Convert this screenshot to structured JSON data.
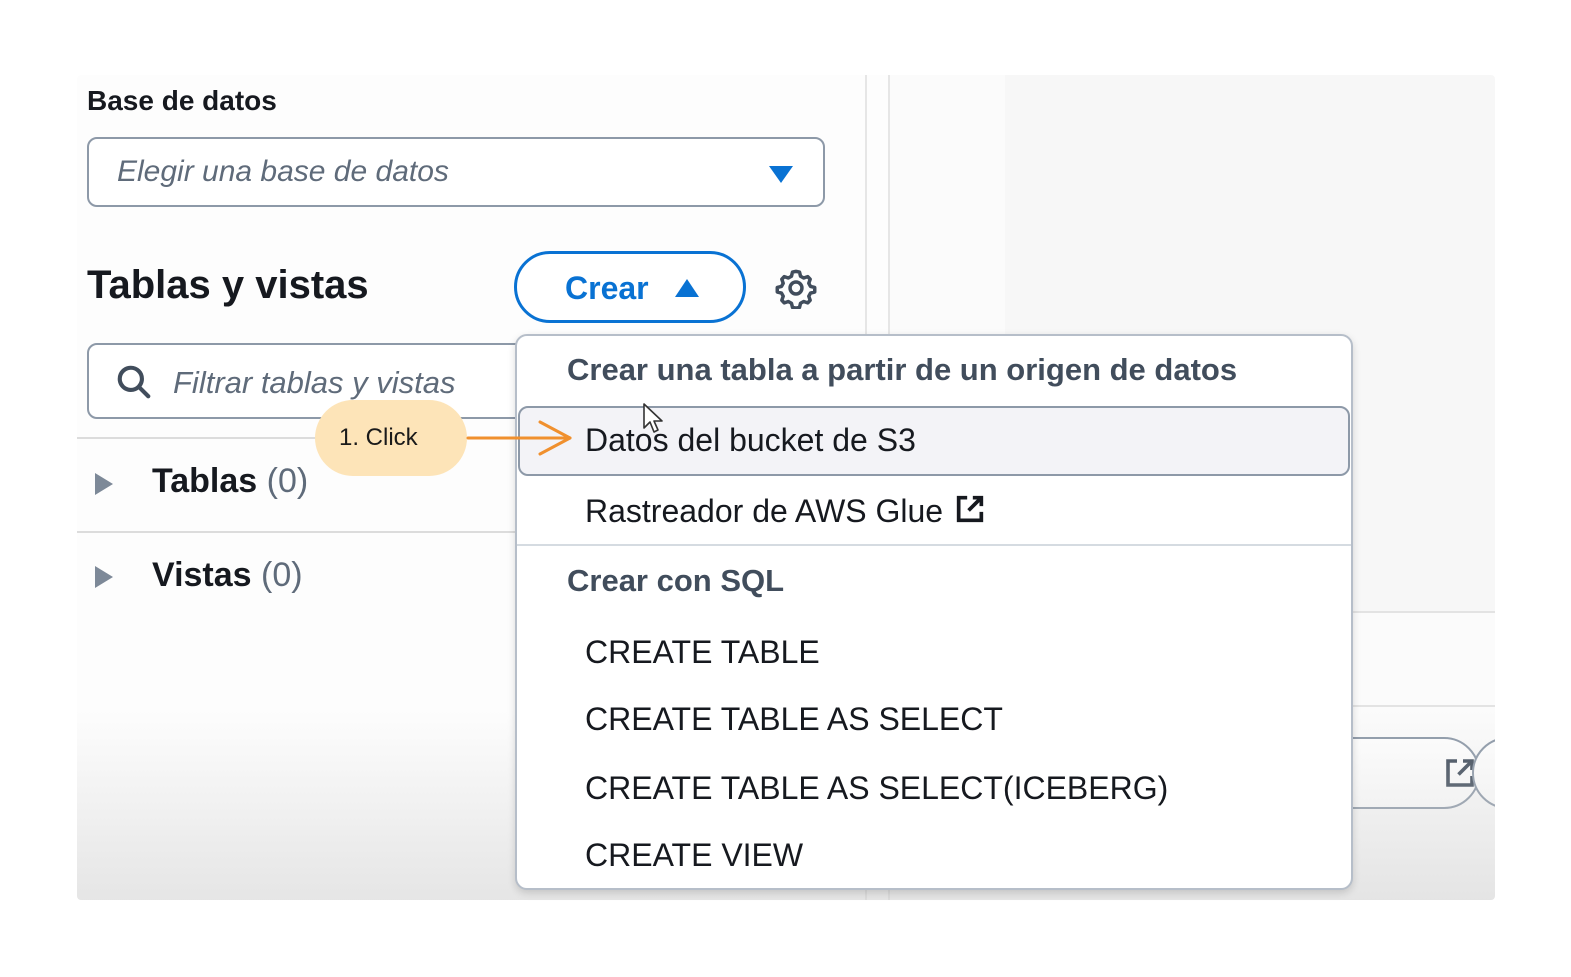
{
  "database": {
    "label": "Base de datos",
    "placeholder": "Elegir una base de datos"
  },
  "tables_views": {
    "title": "Tablas y vistas",
    "create_button": "Crear",
    "filter_placeholder": "Filtrar tablas y vistas",
    "tree": [
      {
        "label": "Tablas",
        "count": "(0)"
      },
      {
        "label": "Vistas",
        "count": "(0)"
      }
    ]
  },
  "create_menu": {
    "group1_heading": "Crear una tabla a partir de un origen de datos",
    "group1_items": [
      "Datos del bucket de S3",
      "Rastreador de AWS Glue"
    ],
    "group2_heading": "Crear con SQL",
    "group2_items": [
      "CREATE TABLE",
      "CREATE TABLE AS SELECT",
      "CREATE TABLE AS SELECT(ICEBERG)",
      "CREATE VIEW"
    ],
    "highlighted_item": "Datos del bucket de S3"
  },
  "annotation": {
    "step_label": "1. Click",
    "callout_color": "#fde4b8",
    "arrow_color": "#f0902e"
  },
  "colors": {
    "accent": "#0972d3",
    "text": "#16191f",
    "muted": "#5f6b7a"
  },
  "icons": [
    "caret-down-icon",
    "caret-up-icon",
    "gear-icon",
    "search-icon",
    "expand-triangle-icon",
    "external-link-icon",
    "mouse-cursor-icon",
    "arrow-icon"
  ]
}
